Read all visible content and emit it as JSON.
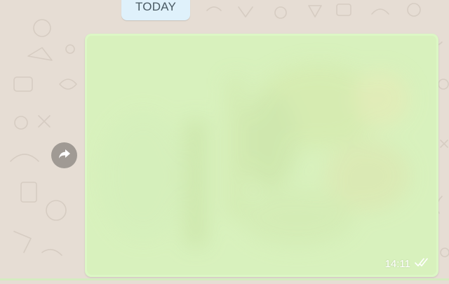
{
  "chat": {
    "date_divider": "TODAY",
    "message": {
      "time": "14:11",
      "status_icon": "double-check-icon",
      "forward_icon": "forward-arrow-icon"
    }
  },
  "colors": {
    "wallpaper": "#e6ddd4",
    "date_chip": "#dff1fb",
    "outgoing_bubble": "#dcf7c5",
    "forward_button": "#a09a94"
  }
}
